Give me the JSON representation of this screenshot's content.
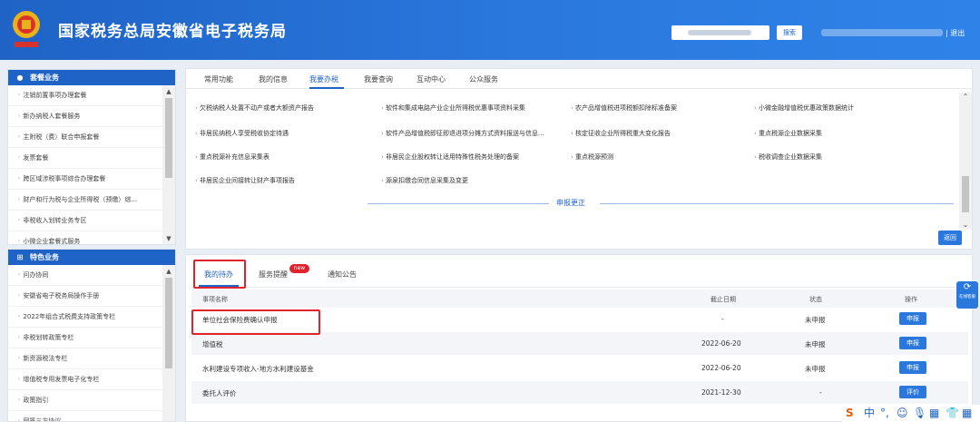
{
  "header": {
    "title": "国家税务总局安徽省电子税务局",
    "search_label": "搜索",
    "logout": "| 退出",
    "emblem_icon": "tax-emblem-icon"
  },
  "sidebar": {
    "section1": {
      "title": "套餐业务",
      "items": [
        "注销前置事项办理套餐",
        "新办纳税人套餐服务",
        "主附税（费）联合申报套餐",
        "发票套餐",
        "跨区域涉税事项综合办理套餐",
        "财产和行为税与企业所得税（预缴）综...",
        "非税收入划转业务专区",
        "小微企业套餐式服务"
      ]
    },
    "section2": {
      "title": "特色业务",
      "items": [
        "问办协同",
        "安徽省电子税务局操作手册",
        "2022年组合式税费支持政策专栏",
        "非税划转政策专栏",
        "新资源税法专栏",
        "增值税专用发票电子化专栏",
        "政策指引",
        "网签三方协议"
      ]
    }
  },
  "top_panel": {
    "tabs": [
      "常用功能",
      "我的信息",
      "我要办税",
      "我要查询",
      "互动中心",
      "公众服务"
    ],
    "active_tab": "我要办税",
    "links": [
      [
        "欠税纳税人处置不动产或者大额资产报告",
        "软件和集成电路产业企业所得税优惠事项资料采集",
        "农产品增值税进项税额扣除标准备案",
        "小微金融增值税优惠政策数据统计"
      ],
      [
        "非居民纳税人享受税收协定待遇",
        "软件产品增值税即征即退进项分摊方式资料报送与信息...",
        "核定征收企业所得税重大变化报告",
        "重点税源企业数据采集"
      ],
      [
        "重点税源补充信息采集表",
        "非居民企业股权转让适用特殊性税务处理的备案",
        "重点税源预测",
        "税收调查企业数据采集"
      ],
      [
        "非居民企业间接转让财产事项报告",
        "源泉扣缴合同信息采集及变更"
      ]
    ],
    "section_label": "申报更正",
    "back_button": "返回"
  },
  "bottom_panel": {
    "tabs": [
      "我的待办",
      "服务提醒",
      "通知公告"
    ],
    "new_badge": "new",
    "columns": [
      "事项名称",
      "截止日期",
      "状态",
      "操作"
    ],
    "rows": [
      {
        "name": "单位社会保险费确认申报",
        "deadline": "-",
        "status": "未申报",
        "action": "申报"
      },
      {
        "name": "增值税",
        "deadline": "2022-06-20",
        "status": "未申报",
        "action": "申报"
      },
      {
        "name": "水利建设专项收入-地方水利建设基金",
        "deadline": "2022-06-20",
        "status": "未申报",
        "action": "申报"
      },
      {
        "name": "委托人评价",
        "deadline": "2021-12-30",
        "status": "-",
        "action": "评价"
      }
    ]
  },
  "float_help": {
    "label": "在线客服"
  },
  "tray": {
    "items": [
      "S",
      "中",
      "°,",
      "☺",
      "🎙",
      "▦",
      "👕",
      "▦"
    ]
  },
  "colors": {
    "primary": "#1f63c6",
    "button": "#2a78de",
    "highlight": "#e0232d"
  }
}
